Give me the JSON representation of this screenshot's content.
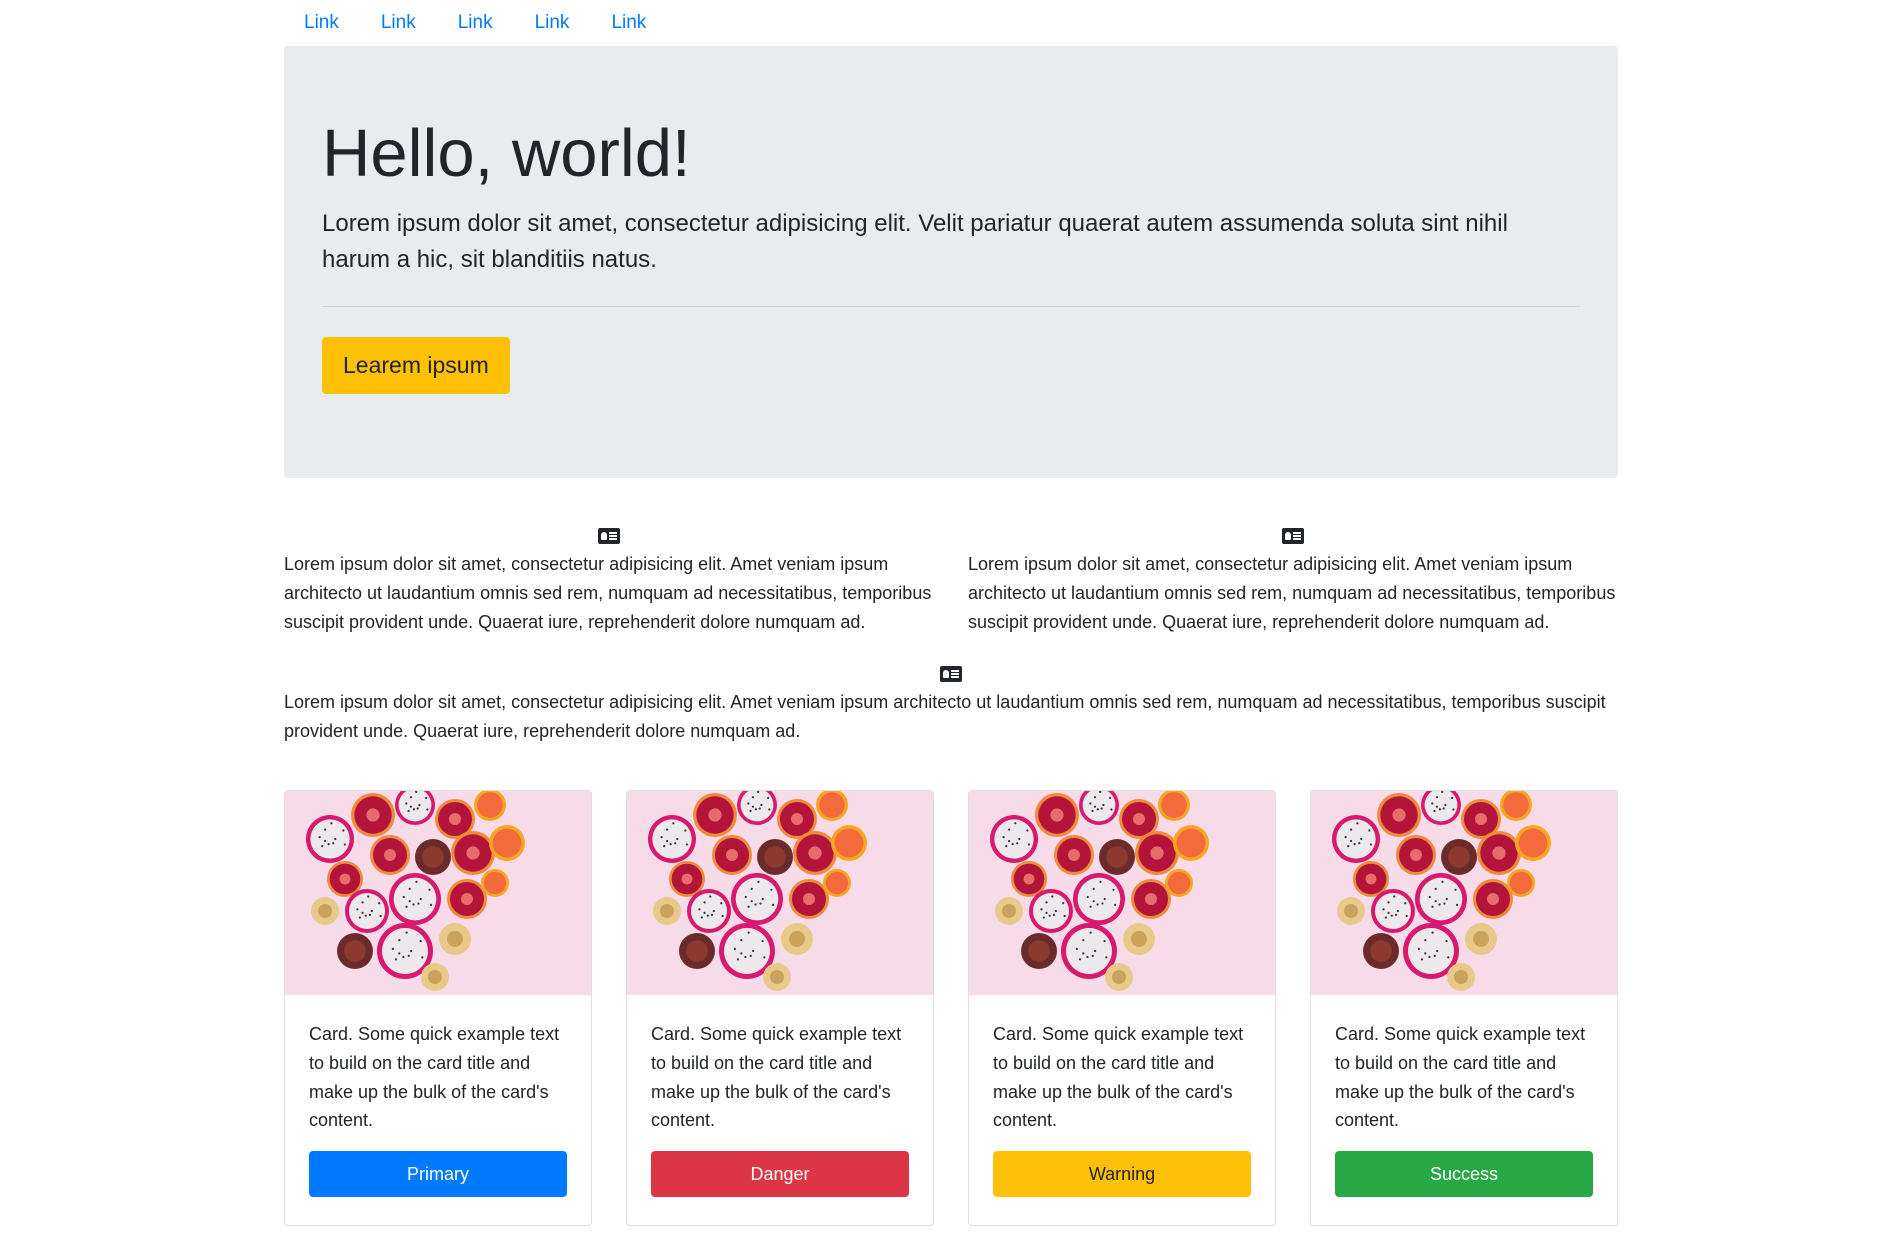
{
  "nav": {
    "links": [
      "Link",
      "Link",
      "Link",
      "Link",
      "Link"
    ]
  },
  "jumbotron": {
    "title": "Hello, world!",
    "lead": "Lorem ipsum dolor sit amet, consectetur adipisicing elit. Velit pariatur quaerat autem assumenda soluta sint nihil harum a hic, sit blanditiis natus.",
    "button_label": "Learem ipsum"
  },
  "features": [
    {
      "icon": "id-card-icon",
      "text": "Lorem ipsum dolor sit amet, consectetur adipisicing elit. Amet veniam ipsum architecto ut laudantium omnis sed rem, numquam ad necessitatibus, temporibus suscipit provident unde. Quaerat iure, reprehenderit dolore numquam ad."
    },
    {
      "icon": "id-card-icon",
      "text": "Lorem ipsum dolor sit amet, consectetur adipisicing elit. Amet veniam ipsum architecto ut laudantium omnis sed rem, numquam ad necessitatibus, temporibus suscipit provident unde. Quaerat iure, reprehenderit dolore numquam ad."
    },
    {
      "icon": "id-card-icon",
      "text": "Lorem ipsum dolor sit amet, consectetur adipisicing elit. Amet veniam ipsum architecto ut laudantium omnis sed rem, numquam ad necessitatibus, temporibus suscipit provident unde. Quaerat iure, reprehenderit dolore numquam ad."
    }
  ],
  "cards": [
    {
      "text": "Card. Some quick example text to build on the card title and make up the bulk of the card's content.",
      "button_label": "Primary",
      "button_color": "#007bff",
      "button_text_color": "#ffffff"
    },
    {
      "text": "Card. Some quick example text to build on the card title and make up the bulk of the card's content.",
      "button_label": "Danger",
      "button_color": "#dc3545",
      "button_text_color": "#ffffff"
    },
    {
      "text": "Card. Some quick example text to build on the card title and make up the bulk of the card's content.",
      "button_label": "Warning",
      "button_color": "#ffc107",
      "button_text_color": "#212529"
    },
    {
      "text": "Card. Some quick example text to build on the card title and make up the bulk of the card's content.",
      "button_label": "Success",
      "button_color": "#28a745",
      "button_text_color": "#ffffff"
    }
  ],
  "colors": {
    "link": "#007bff",
    "jumbotron_bg": "#e9ecef",
    "accent": "#ffc107",
    "card_image_bg": "#f7dbe8"
  }
}
